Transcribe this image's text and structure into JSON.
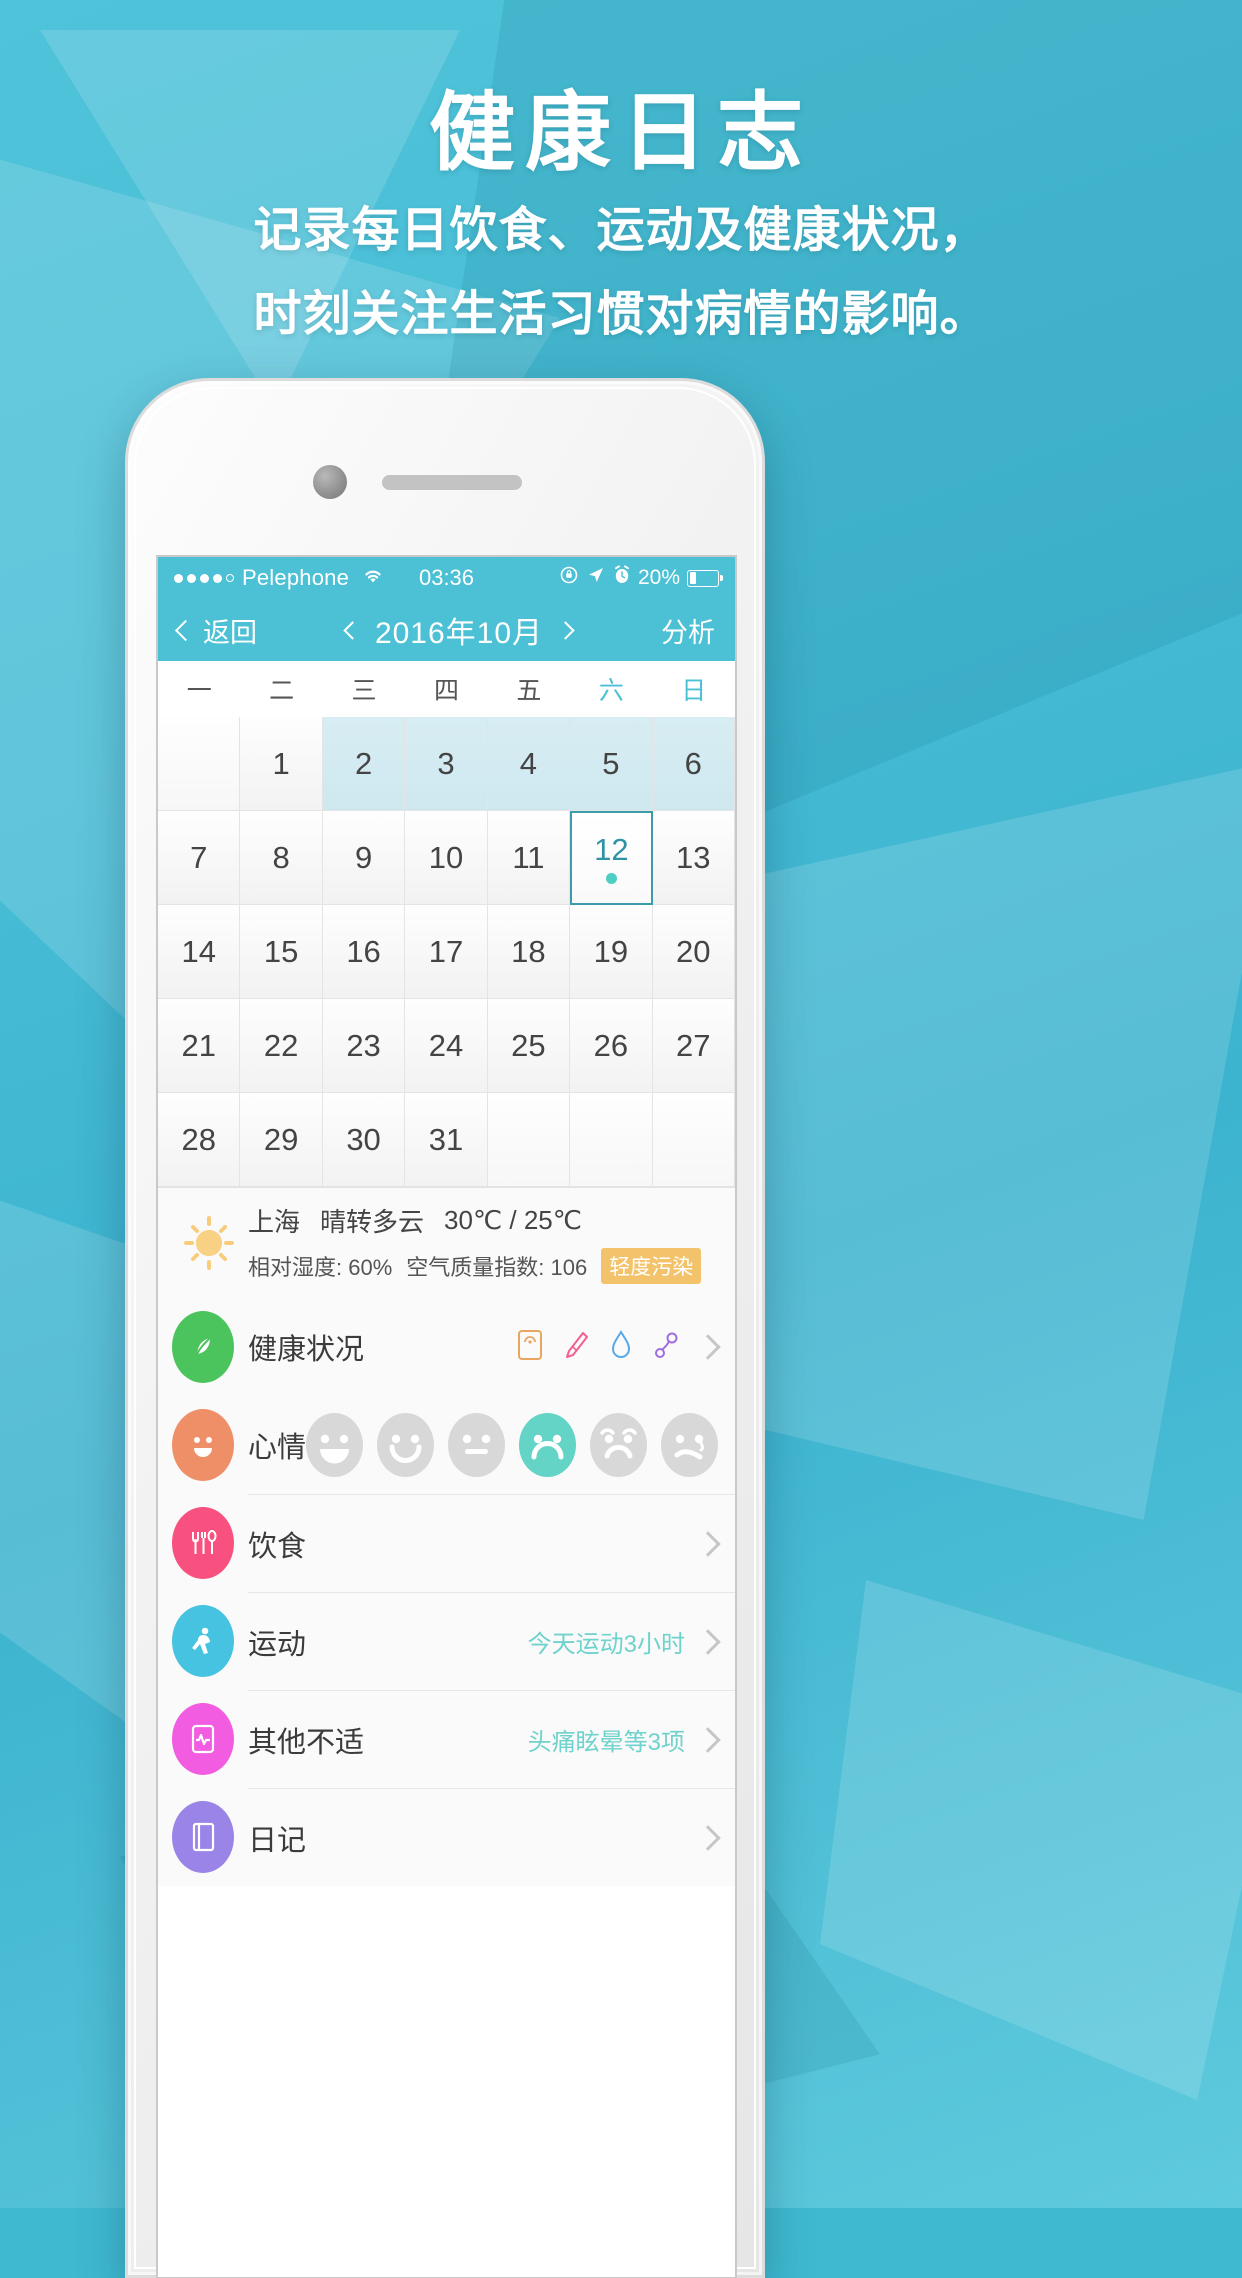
{
  "promo": {
    "title": "健康日志",
    "subtitle_line1": "记录每日饮食、运动及健康状况，",
    "subtitle_line2": "时刻关注生活习惯对病情的影响。"
  },
  "statusbar": {
    "carrier": "Pelephone",
    "time": "03:36",
    "battery_percent": "20%",
    "wifi_icon": "wifi-icon",
    "rotation_lock_icon": "rotation-lock-icon",
    "location_icon": "location-arrow-icon",
    "alarm_icon": "alarm-clock-icon",
    "battery_icon": "battery-icon"
  },
  "navbar": {
    "back_label": "返回",
    "month_title": "2016年10月",
    "right_label": "分析"
  },
  "calendar": {
    "weekdays": [
      "一",
      "二",
      "三",
      "四",
      "五",
      "六",
      "日"
    ],
    "weekend_indexes": [
      5,
      6
    ],
    "weeks": [
      [
        "",
        "1",
        "2",
        "3",
        "4",
        "5",
        "6"
      ],
      [
        "7",
        "8",
        "9",
        "10",
        "11",
        "12",
        "13"
      ],
      [
        "14",
        "15",
        "16",
        "17",
        "18",
        "19",
        "20"
      ],
      [
        "21",
        "22",
        "23",
        "24",
        "25",
        "26",
        "27"
      ],
      [
        "28",
        "29",
        "30",
        "31",
        "",
        "",
        ""
      ]
    ],
    "highlighted": [
      "2",
      "3",
      "4",
      "5",
      "6"
    ],
    "selected": "12",
    "accent_color": "#4cc0d4",
    "selected_border_color": "#3c9cae",
    "selected_dot_color": "#4ecec2"
  },
  "weather": {
    "icon": "sun-cloud-icon",
    "city": "上海",
    "condition": "晴转多云",
    "temperature": "30℃ / 25℃",
    "humidity": "相对湿度: 60%",
    "aqi": "空气质量指数: 106",
    "aqi_badge": "轻度污染",
    "badge_color": "#f3c36b"
  },
  "list": [
    {
      "name": "health-status",
      "icon": "leaf-icon",
      "icon_color": "#4cc45d",
      "label": "健康状况",
      "value": "",
      "sub_icons": [
        "weight-scale-icon",
        "thermometer-icon",
        "water-drop-icon",
        "stethoscope-icon"
      ]
    },
    {
      "name": "mood",
      "icon": "smiley-icon",
      "icon_color": "#ef8f68",
      "label": "心情",
      "value": "",
      "faces": [
        "laugh",
        "smile",
        "neutral",
        "sad",
        "worried",
        "cry"
      ],
      "selected_face_index": 3,
      "selected_face_color": "#63d4c6"
    },
    {
      "name": "diet",
      "icon": "cutlery-icon",
      "icon_color": "#f8517f",
      "label": "饮食",
      "value": ""
    },
    {
      "name": "exercise",
      "icon": "runner-icon",
      "icon_color": "#45c3e0",
      "label": "运动",
      "value": "今天运动3小时"
    },
    {
      "name": "other-discomfort",
      "icon": "pulse-monitor-icon",
      "icon_color": "#f25ce0",
      "label": "其他不适",
      "value": "头痛眩晕等3项"
    },
    {
      "name": "diary",
      "icon": "notebook-icon",
      "icon_color": "#9a84e8",
      "label": "日记",
      "value": ""
    }
  ]
}
